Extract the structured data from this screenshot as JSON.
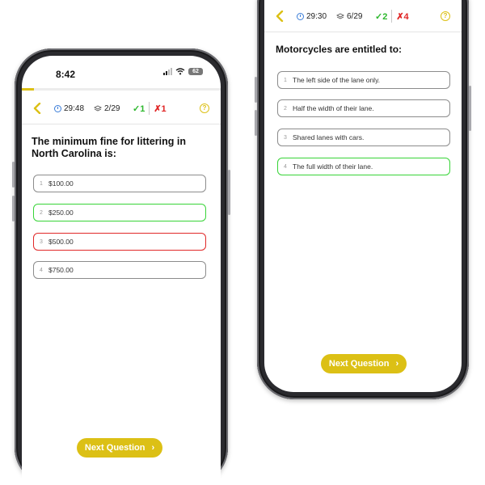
{
  "left_phone": {
    "status": {
      "time": "8:42",
      "battery": "62"
    },
    "progress_fraction": 0.06,
    "header": {
      "timer": "29:48",
      "question_count": "2/29",
      "correct": "✓1",
      "wrong": "✗1",
      "help": "?"
    },
    "question": "The minimum fine for littering in North Carolina is:",
    "answers": [
      {
        "num": "1",
        "text": "$100.00",
        "state": "neutral"
      },
      {
        "num": "2",
        "text": "$250.00",
        "state": "correct"
      },
      {
        "num": "3",
        "text": "$500.00",
        "state": "wrong"
      },
      {
        "num": "4",
        "text": "$750.00",
        "state": "neutral"
      }
    ],
    "next_button": "Next Question"
  },
  "right_phone": {
    "header": {
      "timer": "29:30",
      "question_count": "6/29",
      "correct": "✓2",
      "wrong": "✗4",
      "help": "?"
    },
    "question": "Motorcycles are entitled to:",
    "answers": [
      {
        "num": "1",
        "text": "The left side of the lane only.",
        "state": "neutral"
      },
      {
        "num": "2",
        "text": "Half the width of their lane.",
        "state": "neutral"
      },
      {
        "num": "3",
        "text": "Shared lanes with cars.",
        "state": "neutral"
      },
      {
        "num": "4",
        "text": "The full width of their lane.",
        "state": "correct"
      }
    ],
    "next_button": "Next Question"
  },
  "colors": {
    "accent": "#dcc015",
    "correct": "#37d437",
    "wrong": "#e12828",
    "timer_icon": "#3b7dd8"
  },
  "icons": [
    "back-chevron-icon",
    "clock-icon",
    "layers-icon",
    "help-icon",
    "chevron-right-icon",
    "signal-icon",
    "wifi-icon",
    "battery-icon"
  ]
}
